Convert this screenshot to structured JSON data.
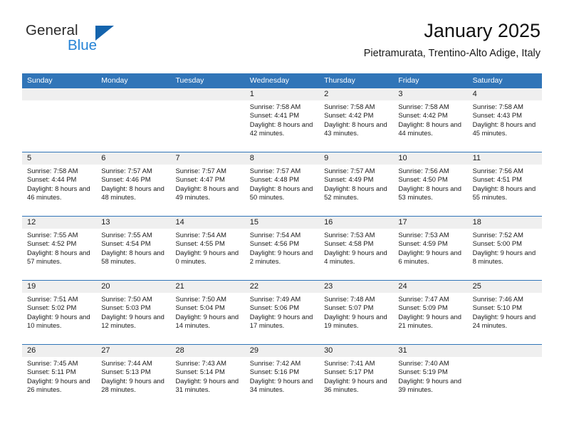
{
  "brand": {
    "name_part1": "General",
    "name_part2": "Blue",
    "color_dark": "#2b2b2b",
    "color_blue": "#2583d6",
    "triangle_color": "#1464ad"
  },
  "header": {
    "title": "January 2025",
    "subtitle": "Pietramurata, Trentino-Alto Adige, Italy",
    "accent_color": "#3175b8",
    "band_color": "#efefef"
  },
  "weekday_headers": [
    "Sunday",
    "Monday",
    "Tuesday",
    "Wednesday",
    "Thursday",
    "Friday",
    "Saturday"
  ],
  "weeks": [
    [
      {
        "day": "",
        "empty": true
      },
      {
        "day": "",
        "empty": true
      },
      {
        "day": "",
        "empty": true
      },
      {
        "day": "1",
        "sunrise": "Sunrise: 7:58 AM",
        "sunset": "Sunset: 4:41 PM",
        "daylight": "Daylight: 8 hours and 42 minutes."
      },
      {
        "day": "2",
        "sunrise": "Sunrise: 7:58 AM",
        "sunset": "Sunset: 4:42 PM",
        "daylight": "Daylight: 8 hours and 43 minutes."
      },
      {
        "day": "3",
        "sunrise": "Sunrise: 7:58 AM",
        "sunset": "Sunset: 4:42 PM",
        "daylight": "Daylight: 8 hours and 44 minutes."
      },
      {
        "day": "4",
        "sunrise": "Sunrise: 7:58 AM",
        "sunset": "Sunset: 4:43 PM",
        "daylight": "Daylight: 8 hours and 45 minutes."
      }
    ],
    [
      {
        "day": "5",
        "sunrise": "Sunrise: 7:58 AM",
        "sunset": "Sunset: 4:44 PM",
        "daylight": "Daylight: 8 hours and 46 minutes."
      },
      {
        "day": "6",
        "sunrise": "Sunrise: 7:57 AM",
        "sunset": "Sunset: 4:46 PM",
        "daylight": "Daylight: 8 hours and 48 minutes."
      },
      {
        "day": "7",
        "sunrise": "Sunrise: 7:57 AM",
        "sunset": "Sunset: 4:47 PM",
        "daylight": "Daylight: 8 hours and 49 minutes."
      },
      {
        "day": "8",
        "sunrise": "Sunrise: 7:57 AM",
        "sunset": "Sunset: 4:48 PM",
        "daylight": "Daylight: 8 hours and 50 minutes."
      },
      {
        "day": "9",
        "sunrise": "Sunrise: 7:57 AM",
        "sunset": "Sunset: 4:49 PM",
        "daylight": "Daylight: 8 hours and 52 minutes."
      },
      {
        "day": "10",
        "sunrise": "Sunrise: 7:56 AM",
        "sunset": "Sunset: 4:50 PM",
        "daylight": "Daylight: 8 hours and 53 minutes."
      },
      {
        "day": "11",
        "sunrise": "Sunrise: 7:56 AM",
        "sunset": "Sunset: 4:51 PM",
        "daylight": "Daylight: 8 hours and 55 minutes."
      }
    ],
    [
      {
        "day": "12",
        "sunrise": "Sunrise: 7:55 AM",
        "sunset": "Sunset: 4:52 PM",
        "daylight": "Daylight: 8 hours and 57 minutes."
      },
      {
        "day": "13",
        "sunrise": "Sunrise: 7:55 AM",
        "sunset": "Sunset: 4:54 PM",
        "daylight": "Daylight: 8 hours and 58 minutes."
      },
      {
        "day": "14",
        "sunrise": "Sunrise: 7:54 AM",
        "sunset": "Sunset: 4:55 PM",
        "daylight": "Daylight: 9 hours and 0 minutes."
      },
      {
        "day": "15",
        "sunrise": "Sunrise: 7:54 AM",
        "sunset": "Sunset: 4:56 PM",
        "daylight": "Daylight: 9 hours and 2 minutes."
      },
      {
        "day": "16",
        "sunrise": "Sunrise: 7:53 AM",
        "sunset": "Sunset: 4:58 PM",
        "daylight": "Daylight: 9 hours and 4 minutes."
      },
      {
        "day": "17",
        "sunrise": "Sunrise: 7:53 AM",
        "sunset": "Sunset: 4:59 PM",
        "daylight": "Daylight: 9 hours and 6 minutes."
      },
      {
        "day": "18",
        "sunrise": "Sunrise: 7:52 AM",
        "sunset": "Sunset: 5:00 PM",
        "daylight": "Daylight: 9 hours and 8 minutes."
      }
    ],
    [
      {
        "day": "19",
        "sunrise": "Sunrise: 7:51 AM",
        "sunset": "Sunset: 5:02 PM",
        "daylight": "Daylight: 9 hours and 10 minutes."
      },
      {
        "day": "20",
        "sunrise": "Sunrise: 7:50 AM",
        "sunset": "Sunset: 5:03 PM",
        "daylight": "Daylight: 9 hours and 12 minutes."
      },
      {
        "day": "21",
        "sunrise": "Sunrise: 7:50 AM",
        "sunset": "Sunset: 5:04 PM",
        "daylight": "Daylight: 9 hours and 14 minutes."
      },
      {
        "day": "22",
        "sunrise": "Sunrise: 7:49 AM",
        "sunset": "Sunset: 5:06 PM",
        "daylight": "Daylight: 9 hours and 17 minutes."
      },
      {
        "day": "23",
        "sunrise": "Sunrise: 7:48 AM",
        "sunset": "Sunset: 5:07 PM",
        "daylight": "Daylight: 9 hours and 19 minutes."
      },
      {
        "day": "24",
        "sunrise": "Sunrise: 7:47 AM",
        "sunset": "Sunset: 5:09 PM",
        "daylight": "Daylight: 9 hours and 21 minutes."
      },
      {
        "day": "25",
        "sunrise": "Sunrise: 7:46 AM",
        "sunset": "Sunset: 5:10 PM",
        "daylight": "Daylight: 9 hours and 24 minutes."
      }
    ],
    [
      {
        "day": "26",
        "sunrise": "Sunrise: 7:45 AM",
        "sunset": "Sunset: 5:11 PM",
        "daylight": "Daylight: 9 hours and 26 minutes."
      },
      {
        "day": "27",
        "sunrise": "Sunrise: 7:44 AM",
        "sunset": "Sunset: 5:13 PM",
        "daylight": "Daylight: 9 hours and 28 minutes."
      },
      {
        "day": "28",
        "sunrise": "Sunrise: 7:43 AM",
        "sunset": "Sunset: 5:14 PM",
        "daylight": "Daylight: 9 hours and 31 minutes."
      },
      {
        "day": "29",
        "sunrise": "Sunrise: 7:42 AM",
        "sunset": "Sunset: 5:16 PM",
        "daylight": "Daylight: 9 hours and 34 minutes."
      },
      {
        "day": "30",
        "sunrise": "Sunrise: 7:41 AM",
        "sunset": "Sunset: 5:17 PM",
        "daylight": "Daylight: 9 hours and 36 minutes."
      },
      {
        "day": "31",
        "sunrise": "Sunrise: 7:40 AM",
        "sunset": "Sunset: 5:19 PM",
        "daylight": "Daylight: 9 hours and 39 minutes."
      },
      {
        "day": "",
        "empty": true
      }
    ]
  ]
}
